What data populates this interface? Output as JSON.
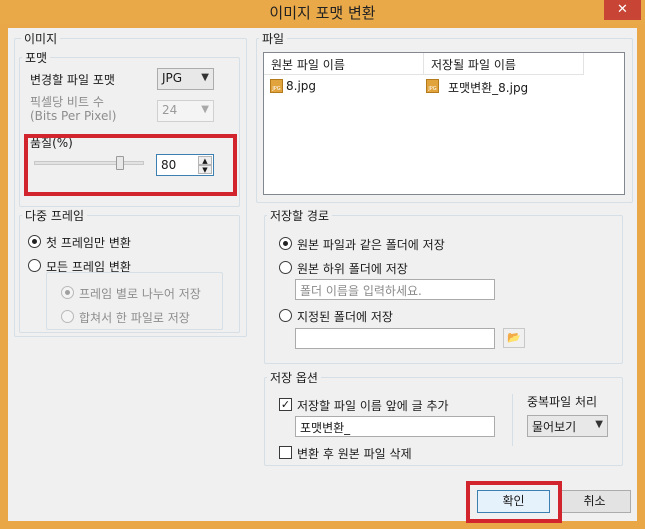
{
  "window": {
    "title": "이미지 포맷 변환",
    "close_glyph": "✕"
  },
  "image_group": {
    "title": "이미지",
    "format_group": {
      "title": "포맷",
      "format_label": "변경할 파일 포맷",
      "format_value": "JPG",
      "bpp_label": "픽셀당 비트 수",
      "bpp_sublabel": "(Bits Per Pixel)",
      "bpp_value": "24",
      "quality_label": "품질(%)",
      "quality_value": "80",
      "quality_fraction": 0.8
    },
    "multi_frame_group": {
      "title": "다중 프레임",
      "first_frame": "첫 프레임만 변환",
      "all_frames": "모든 프레임 변환",
      "split_save": "프레임 별로 나누어 저장",
      "merge_save": "합쳐서 한 파일로 저장"
    }
  },
  "file_group": {
    "title": "파일",
    "columns": [
      "원본 파일 이름",
      "저장될 파일 이름"
    ],
    "rows": [
      {
        "original": "8.jpg",
        "saved": "포맷변환_8.jpg"
      }
    ],
    "file_icon_text": "JPG"
  },
  "save_path_group": {
    "title": "저장할 경로",
    "same_folder": "원본 파일과 같은 폴더에 저장",
    "sub_folder": "원본 하위 폴더에 저장",
    "sub_folder_placeholder": "폴더 이름을 입력하세요.",
    "specified_folder": "지정된 폴더에 저장",
    "specified_folder_value": ""
  },
  "save_options_group": {
    "title": "저장 옵션",
    "prefix_label": "저장할 파일 이름 앞에 글 추가",
    "prefix_checked": true,
    "prefix_value": "포맷변환_",
    "delete_original_label": "변환 후 원본 파일 삭제",
    "delete_original_checked": false,
    "duplicate_label": "중복파일 처리",
    "duplicate_value": "물어보기"
  },
  "buttons": {
    "ok": "확인",
    "cancel": "취소"
  },
  "colors": {
    "highlight": "#d1242c",
    "title_bar": "#eaa948",
    "close": "#c84435"
  }
}
